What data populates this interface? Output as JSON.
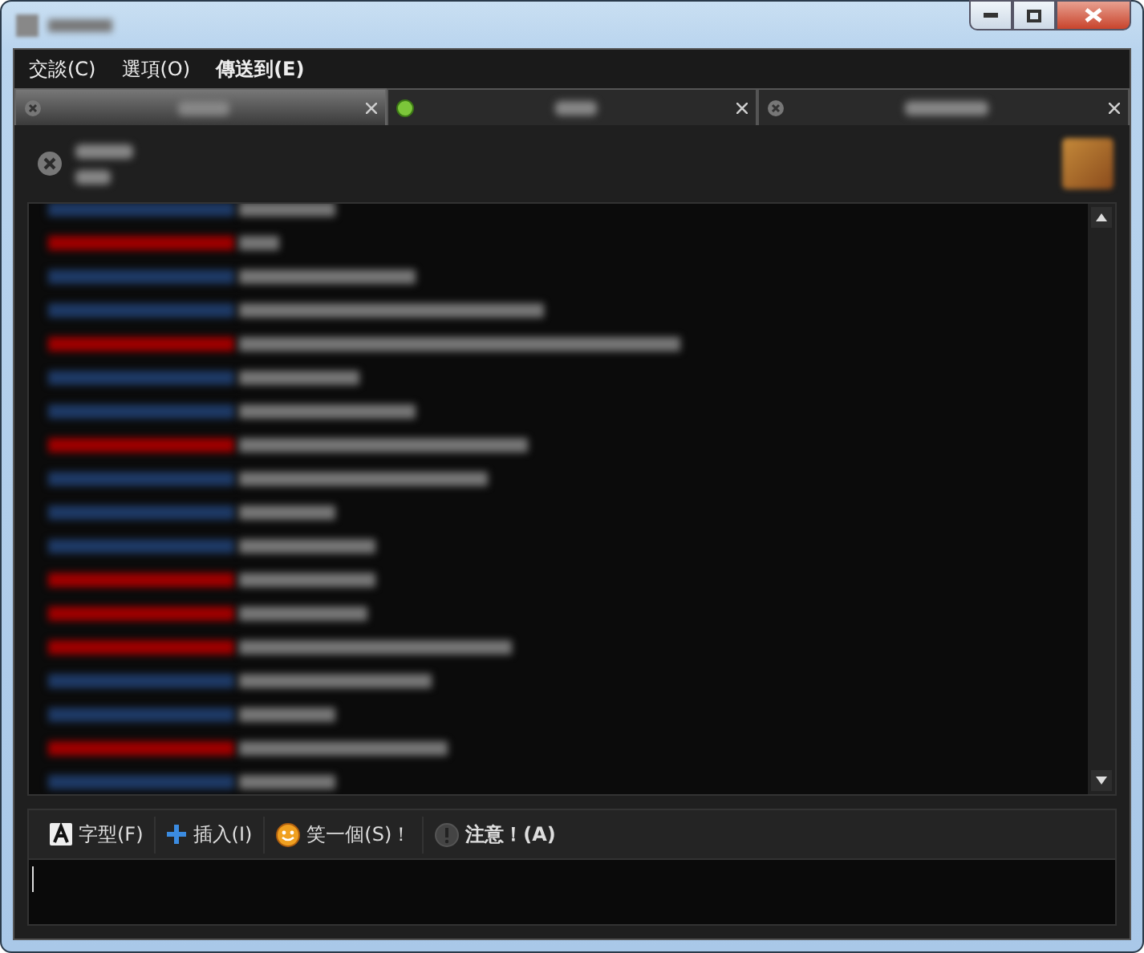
{
  "menu": [
    "交談(C)",
    "選項(O)",
    "傳送到(E)"
  ],
  "tabs": [
    {
      "selected": true,
      "kind": "offline"
    },
    {
      "selected": false,
      "kind": "online"
    },
    {
      "selected": false,
      "kind": "offline"
    }
  ],
  "messages": [
    {
      "color": "#1e3a66"
    },
    {
      "color": "#a00000"
    },
    {
      "color": "#1e3a66"
    },
    {
      "color": "#1e3a66"
    },
    {
      "color": "#a00000"
    },
    {
      "color": "#1e3a66"
    },
    {
      "color": "#1e3a66"
    },
    {
      "color": "#a00000"
    },
    {
      "color": "#1e3a66"
    },
    {
      "color": "#1e3a66"
    },
    {
      "color": "#1e3a66"
    },
    {
      "color": "#a00000"
    },
    {
      "color": "#a00000"
    },
    {
      "color": "#a00000"
    },
    {
      "color": "#1e3a66"
    },
    {
      "color": "#1e3a66"
    },
    {
      "color": "#a00000"
    },
    {
      "color": "#1e3a66"
    }
  ],
  "toolbar": [
    {
      "kind": "font",
      "label": "字型(F)"
    },
    {
      "kind": "insert",
      "label": "插入(I)"
    },
    {
      "kind": "smile",
      "label": "笑一個(S)！"
    },
    {
      "kind": "nudge",
      "label": "注意！(A)"
    }
  ]
}
